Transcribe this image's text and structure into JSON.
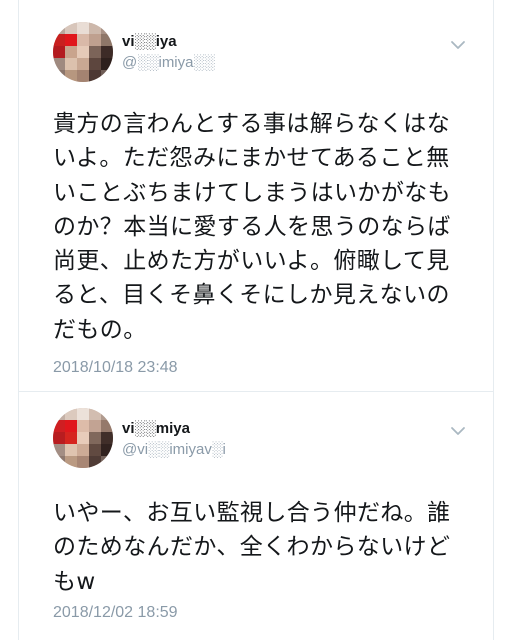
{
  "colors": {
    "text": "#14171a",
    "secondary_text": "#8a9aa8",
    "divider": "#e6ecf0",
    "background": "#ffffff",
    "avatar_accent": "#e0171c"
  },
  "tweets": [
    {
      "display_name": "vi░░iya",
      "handle": "@░░imiya░░",
      "text": "貴方の言わんとする事は解らなくはないよ。ただ怨みにまかせてあること無いことぶちまけてしまうはいかがなものか？本当に愛する人を思うのならば尚更、止めた方がいいよ。俯瞰して見ると、目くそ鼻くそにしか見えないのだもの。",
      "timestamp": "2018/10/18 23:48",
      "menu_icon": "chevron-down-icon"
    },
    {
      "display_name": "vi░░miya",
      "handle": "@vi░░imiyav░i",
      "text": "いやー、お互い監視し合う仲だね。誰のためなんだか、全くわからないけどもw",
      "timestamp": "2018/12/02 18:59",
      "menu_icon": "chevron-down-icon"
    }
  ]
}
